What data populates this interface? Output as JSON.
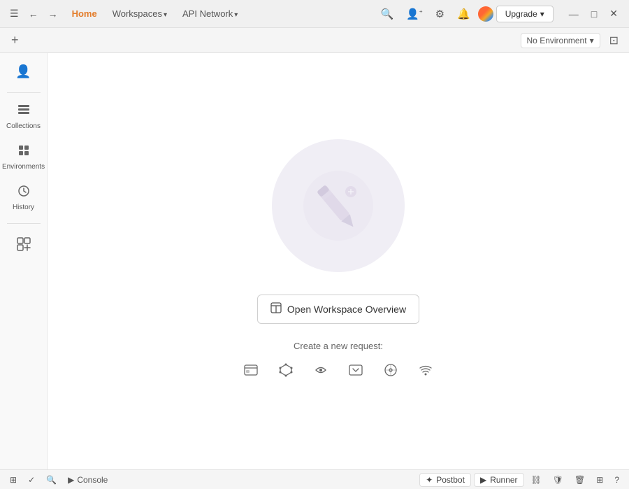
{
  "titlebar": {
    "hamburger": "☰",
    "back": "←",
    "forward": "→",
    "home_label": "Home",
    "workspaces_label": "Workspaces",
    "api_network_label": "API Network",
    "search_icon": "🔍",
    "invite_icon": "👤+",
    "settings_icon": "⚙",
    "bell_icon": "🔔",
    "upgrade_label": "Upgrade",
    "upgrade_chevron": "▾",
    "minimize_icon": "—",
    "maximize_icon": "□",
    "close_icon": "✕"
  },
  "tabsbar": {
    "add_tab_icon": "+",
    "env_selector_label": "No Environment",
    "env_chevron": "▾",
    "layout_icon": "⊞"
  },
  "sidebar": {
    "items": [
      {
        "id": "account",
        "icon": "👤",
        "label": ""
      },
      {
        "id": "collections",
        "icon": "📁",
        "label": "Collections"
      },
      {
        "id": "environments",
        "icon": "⊞",
        "label": "Environments"
      },
      {
        "id": "history",
        "icon": "🕐",
        "label": "History"
      }
    ],
    "grid_add_icon": "⊞+"
  },
  "content": {
    "empty_state_label": "",
    "open_workspace_icon": "✏",
    "open_workspace_label": "Open Workspace Overview",
    "create_request_label": "Create a new request:",
    "create_icons": [
      {
        "id": "http-request",
        "symbol": "⊞",
        "title": "HTTP Request"
      },
      {
        "id": "graphql",
        "symbol": "✦",
        "title": "GraphQL"
      },
      {
        "id": "grpc",
        "symbol": "⌘",
        "title": "gRPC"
      },
      {
        "id": "websocket",
        "symbol": "◫",
        "title": "WebSocket"
      },
      {
        "id": "socketio",
        "symbol": "◎",
        "title": "Socket.IO"
      },
      {
        "id": "mqtt",
        "symbol": "≋",
        "title": "MQTT"
      }
    ]
  },
  "bottombar": {
    "bottom_icon_1": "⊞",
    "bottom_icon_2": "✓",
    "bottom_icon_3": "🔍",
    "console_icon": "▶",
    "console_label": "Console",
    "postbot_icon": "✦",
    "postbot_label": "Postbot",
    "runner_icon": "▶",
    "runner_label": "Runner",
    "link_icon": "⛓",
    "shield_icon": "🛡",
    "trash_icon": "🗑",
    "grid_icon": "⊞",
    "help_icon": "?"
  }
}
